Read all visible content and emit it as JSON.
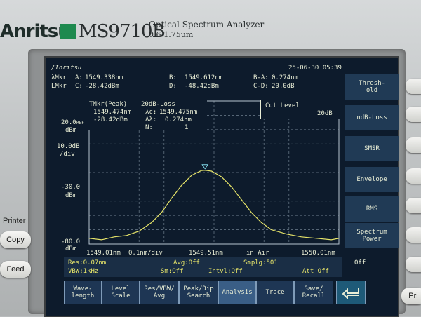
{
  "header": {
    "brand": "Anritsu",
    "model": "MS9710B",
    "title": "Optical Spectrum Analyzer",
    "range": "0.6-1.75μm"
  },
  "screen": {
    "logo": "/Inritsu",
    "datetime": "25-06-30 05:39",
    "marker_rows": [
      {
        "label": "λMkr",
        "a_label": "A:",
        "a_val": "1549.338nm",
        "b_label": "B:",
        "b_val": "1549.612nm",
        "d_label": "B-A:",
        "d_val": "0.274nm"
      },
      {
        "label": "LMkr",
        "a_label": "C:",
        "a_val": "-28.42dBm",
        "b_label": "D:",
        "b_val": "-48.42dBm",
        "d_label": "C-D:",
        "d_val": "20.0dB"
      }
    ],
    "tmkr": {
      "title": "TMkr(Peak)",
      "mode": "20dB-Loss",
      "wl": "1549.474nm",
      "lc_label": "λc:",
      "lc_val": "1549.475nm",
      "pw": "-28.42dBm",
      "dl_label": "Δλ:",
      "dl_val": "0.274nm",
      "n_label": "N:",
      "n_val": "1"
    },
    "cut_level": {
      "label": "Cut Level",
      "value": "20dB"
    },
    "ref_level": "20.0",
    "ref_unit": "dBm",
    "ref_tag": "REF",
    "scale": "10.0dB",
    "scale_unit": "/div",
    "mid_level": "-30.0",
    "mid_unit": "dBm",
    "bottom_level": "-80.0",
    "bottom_unit": "dBm",
    "x_start": "1549.01nm",
    "x_div": "0.1nm/div",
    "x_center": "1549.51nm",
    "x_medium": "in Air",
    "x_end": "1550.01nm",
    "status": {
      "res": "Res:0.07nm",
      "avg": "Avg:Off",
      "smplg": "Smplg:501",
      "vbw": "VBW:1kHz",
      "sm": "Sm:Off",
      "intvl": "Intvl:Off",
      "att": "Att Off",
      "off": "Off"
    },
    "softkeys": [
      "Thresh-\nold",
      "ndB-Loss",
      "SMSR",
      "Envelope",
      "RMS",
      "Spectrum\nPower"
    ],
    "tabs": [
      "Wave-\nlength",
      "Level\nScale",
      "Res/VBW/\nAvg",
      "Peak/Dip\nSearch",
      "Analysis",
      "Trace",
      "Save/\nRecall"
    ],
    "active_tab": "Analysis",
    "chart_data": {
      "type": "line",
      "x_unit": "nm",
      "y_unit": "dBm",
      "xlim": [
        1549.01,
        1550.01
      ],
      "ylim": [
        -80,
        20
      ],
      "grid": true,
      "series": [
        {
          "color": "#e8e66a",
          "x": [
            1549.01,
            1549.06,
            1549.11,
            1549.16,
            1549.21,
            1549.26,
            1549.3,
            1549.34,
            1549.38,
            1549.42,
            1549.46,
            1549.474,
            1549.5,
            1549.54,
            1549.58,
            1549.62,
            1549.66,
            1549.7,
            1549.74,
            1549.8,
            1549.86,
            1549.92,
            1549.98,
            1550.01
          ],
          "y": [
            -76,
            -77,
            -75,
            -74,
            -71,
            -65,
            -58,
            -48,
            -39,
            -32,
            -28.6,
            -28.42,
            -29,
            -33,
            -40,
            -49,
            -58,
            -65,
            -70,
            -73,
            -75,
            -76,
            -77,
            -76
          ]
        }
      ]
    }
  },
  "panel": {
    "printer_label": "Printer",
    "copy_label": "Copy",
    "feed_label": "Feed",
    "right_label": "Pri"
  }
}
